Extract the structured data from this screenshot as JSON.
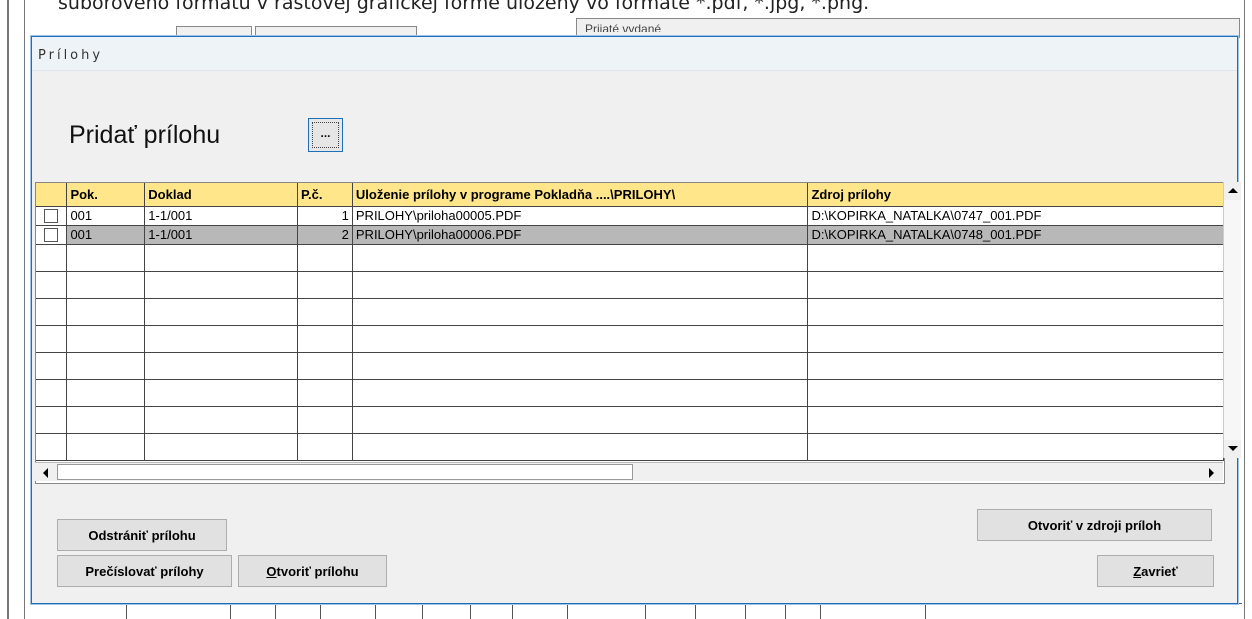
{
  "background": {
    "top_text": "súborového formátu v rastovej grafickej forme uložený vo formáte *.pdf, *.jpg, *.png.",
    "partial_label": "Prijaté vydané"
  },
  "dialog": {
    "title": "Prílohy",
    "heading": "Pridať prílohu",
    "browse_button_label": "...",
    "grid": {
      "columns": [
        "Pok.",
        "Doklad",
        "P.č.",
        "Uloženie prílohy v programe Pokladňa ....\\PRILOHY\\",
        "Zdroj prílohy"
      ],
      "rows": [
        {
          "checked": false,
          "pok": "001",
          "doklad": "1-1/001",
          "pc": "1",
          "ulozenie": "PRILOHY\\priloha00005.PDF",
          "zdroj": "D:\\KOPIRKA_NATALKA\\0747_001.PDF",
          "selected": false
        },
        {
          "checked": false,
          "pok": "001",
          "doklad": "1-1/001",
          "pc": "2",
          "ulozenie": "PRILOHY\\priloha00006.PDF",
          "zdroj": "D:\\KOPIRKA_NATALKA\\0748_001.PDF",
          "selected": true
        }
      ]
    },
    "buttons": {
      "remove": "Odstrániť prílohu",
      "renumber": "Prečíslovať prílohy",
      "open_prefix": "O",
      "open_rest": "tvoriť prílohu",
      "open_source": "Otvoriť v zdroji príloh",
      "close_prefix": "Z",
      "close_rest": "avrieť"
    },
    "icons": {
      "scroll_up": "arrow-up-icon",
      "scroll_down": "arrow-down-icon",
      "scroll_left": "arrow-left-icon",
      "scroll_right": "arrow-right-icon",
      "checkbox": "checkbox-icon"
    },
    "colors": {
      "header_bg": "#ffe68a",
      "selected_row": "#b8b8b8",
      "dialog_border": "#1f6fb8"
    }
  }
}
